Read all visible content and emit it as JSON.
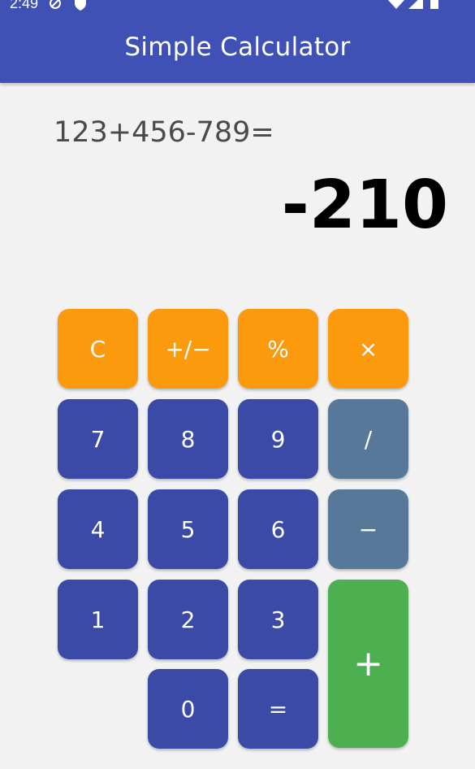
{
  "status_bar": {
    "time": "2:49",
    "icons": [
      "data-saver-icon",
      "shield-icon",
      "wifi-icon",
      "signal-icon",
      "battery-icon"
    ]
  },
  "app_bar": {
    "title": "Simple Calculator",
    "color": "#3f51b5"
  },
  "display": {
    "expression": "123+456-789=",
    "result": "-210"
  },
  "keypad": {
    "clear": "C",
    "plus_minus": "+/−",
    "percent": "%",
    "multiply": "×",
    "seven": "7",
    "eight": "8",
    "nine": "9",
    "divide": "/",
    "four": "4",
    "five": "5",
    "six": "6",
    "subtract": "−",
    "one": "1",
    "two": "2",
    "three": "3",
    "add": "+",
    "zero": "0",
    "equals": "="
  },
  "colors": {
    "function_keys": "#fb9a0c",
    "digit_keys": "#3a4aa6",
    "operator_keys": "#58789a",
    "add_key": "#4caf50"
  }
}
